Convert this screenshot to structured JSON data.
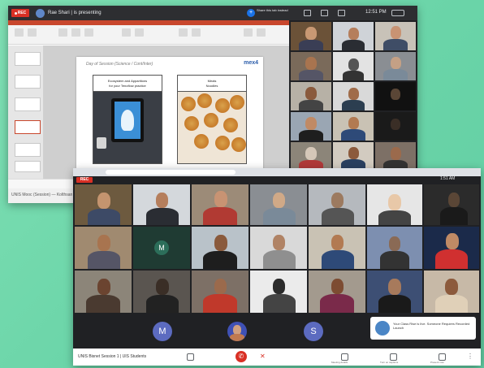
{
  "meeting_top": {
    "title": "Rae Shari | is presenting",
    "rec_label": "REC",
    "present_label": "Share this tab instead",
    "clock": "12:51 PM",
    "people_count": "34"
  },
  "presentation": {
    "slide_title": "Day of Session (Science / Cont/Inter)",
    "logo": "mex4",
    "box_left_line1": "Ecosystem and Apparitions",
    "box_left_line2": "for your Tenoflow practice",
    "box_right_line1": "Meals",
    "box_right_line2": "Noodles",
    "status": "UNIS Mooc (Session) — Kolthsan"
  },
  "meeting_bottom": {
    "rec_label": "REC",
    "clock": "1:51 AM",
    "avatars": [
      "M",
      "S"
    ],
    "tile_initial": "M",
    "toast_text": "Your Class Rise is live. Someone Requires Recorded Launch",
    "bottom_text": "UNIS Bisnet Session 1 | UIS Students",
    "controls": {
      "meeting_details": "Meeting details",
      "turn_captions": "Turn on captions",
      "present_now": "Present now"
    }
  }
}
